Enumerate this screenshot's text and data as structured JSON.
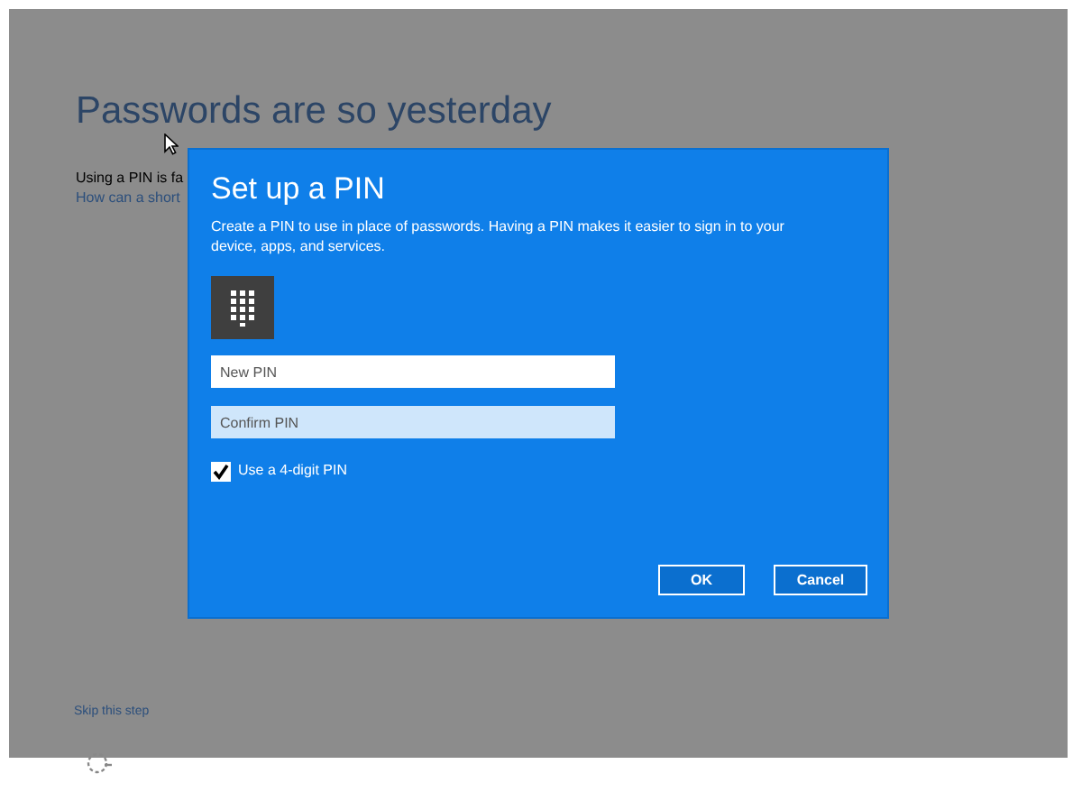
{
  "page": {
    "title": "Passwords are so yesterday",
    "body_lines": [
      "Using a PIN is fa",
      "How can a short"
    ],
    "skip_link": "Skip this step"
  },
  "dialog": {
    "title": "Set up a PIN",
    "description": "Create a PIN to use in place of passwords. Having a PIN makes it easier to sign in to your device, apps, and services.",
    "fields": [
      {
        "placeholder": "New PIN",
        "focused": false
      },
      {
        "placeholder": "Confirm PIN",
        "focused": true
      }
    ],
    "checkbox": {
      "label": "Use a 4-digit PIN",
      "checked": true
    },
    "buttons": [
      "OK",
      "Cancel"
    ]
  }
}
